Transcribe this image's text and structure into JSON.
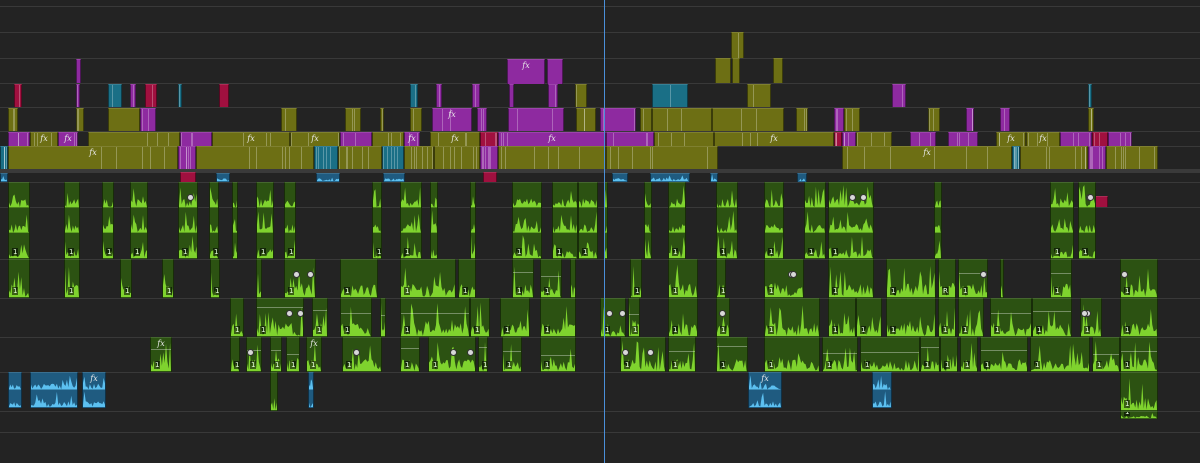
{
  "app": {
    "panel": "timeline-sequence"
  },
  "colors": {
    "background": "#232323",
    "track_separator": "#393939",
    "playhead": "#4a8fd9",
    "video_purple": "#8e2aa0",
    "video_olive": "#6d6f14",
    "video_teal": "#1a6f86",
    "video_crimson": "#a0103f",
    "audio_green_bg": "#2c5212",
    "audio_green_wave": "#7fd32e",
    "audio_blue_bg": "#1f5b80",
    "audio_blue_wave": "#5cc0f0"
  },
  "labels": {
    "fx": "fx",
    "channel": "1",
    "channel_r": "R"
  },
  "icons": {
    "effect_badge": "fx-badge-icon",
    "keyframe": "keyframe-icon",
    "playhead": "playhead-icon"
  }
}
